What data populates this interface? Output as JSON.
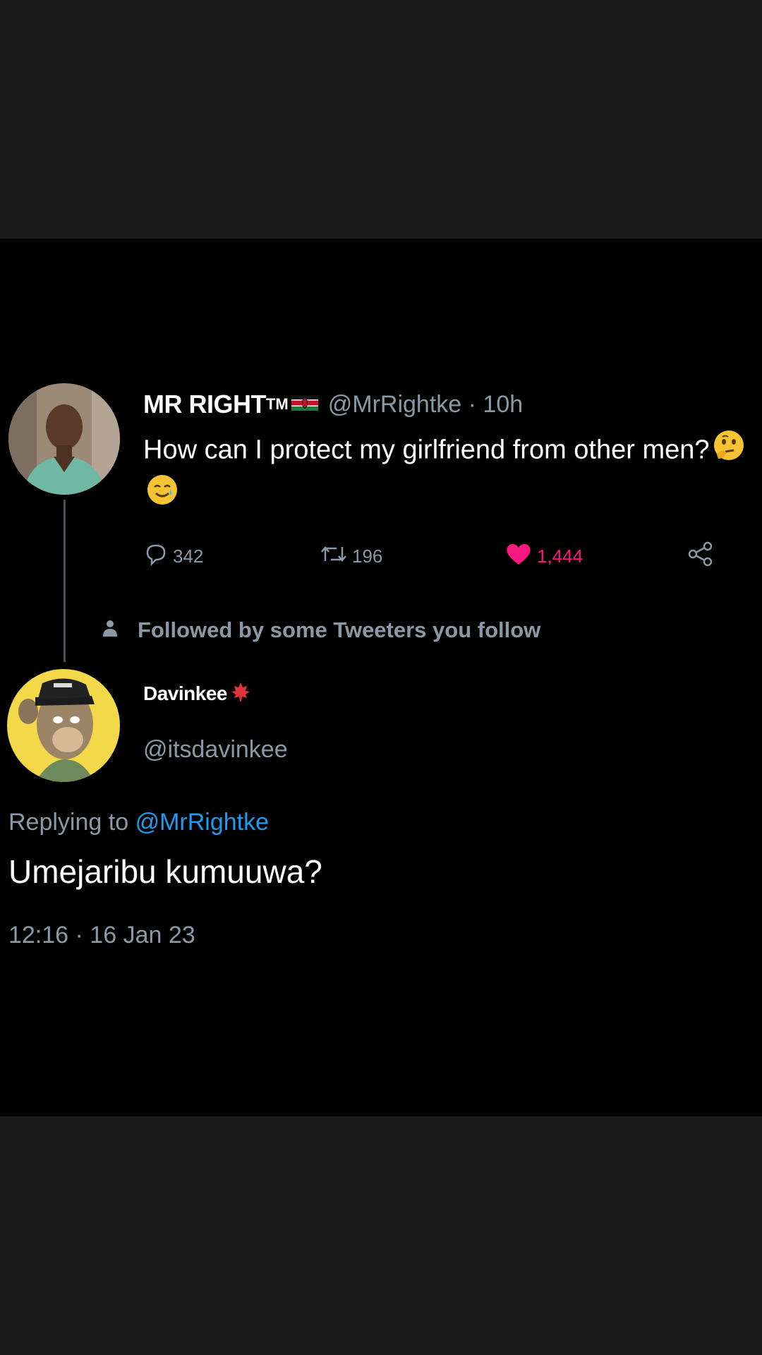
{
  "tweet": {
    "display_name": "MR RIGHT",
    "tm": "TM",
    "handle_time": "@MrRightke · 10h",
    "text": "How can I protect my girlfriend from other men?",
    "emoji_1": "thinking-face-icon",
    "emoji_2": "smiling-face-with-tear-icon",
    "replies": "342",
    "retweets": "196",
    "likes": "1,444",
    "like_color": "#f91880"
  },
  "context": {
    "followed_text": "Followed by some Tweeters you follow"
  },
  "reply": {
    "display_name": "Davinkee",
    "name_icon": "maple-leaf-icon",
    "handle": "@itsdavinkee",
    "replying_prefix": "Replying to",
    "replying_mention": "@MrRightke",
    "text": "Umejaribu kumuuwa?",
    "timestamp": "12:16 · 16 Jan 23"
  },
  "colors": {
    "background": "#000000",
    "outer_band": "#1c1c1c",
    "secondary_text": "#8b98a5",
    "link": "#1d9bf0"
  }
}
